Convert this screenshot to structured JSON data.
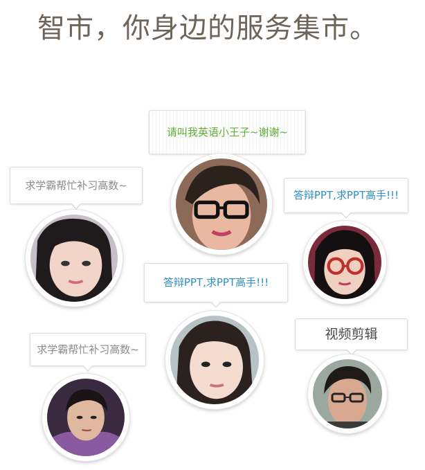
{
  "headline": "智市，你身边的服务集市。",
  "requests": [
    {
      "text": "请叫我英语小王子~谢谢~",
      "color": "#5fae35",
      "icon": "male-glasses-avatar"
    },
    {
      "text": "求学霸帮忙补习高数~",
      "color": "#8b8b8b",
      "icon": "female-long-hair-avatar"
    },
    {
      "text": "答辩PPT,求PPT高手!!!",
      "color": "#2f8fbf",
      "icon": "female-glasses-avatar"
    },
    {
      "text": "答辩PPT,求PPT高手!!!",
      "color": "#2f8fbf",
      "icon": "female-avatar"
    },
    {
      "text": "视频剪辑",
      "color": "#4a4a4a",
      "icon": "male-glasses-avatar"
    },
    {
      "text": "求学霸帮忙补习高数~",
      "color": "#8b8b8b",
      "icon": "male-avatar"
    }
  ]
}
